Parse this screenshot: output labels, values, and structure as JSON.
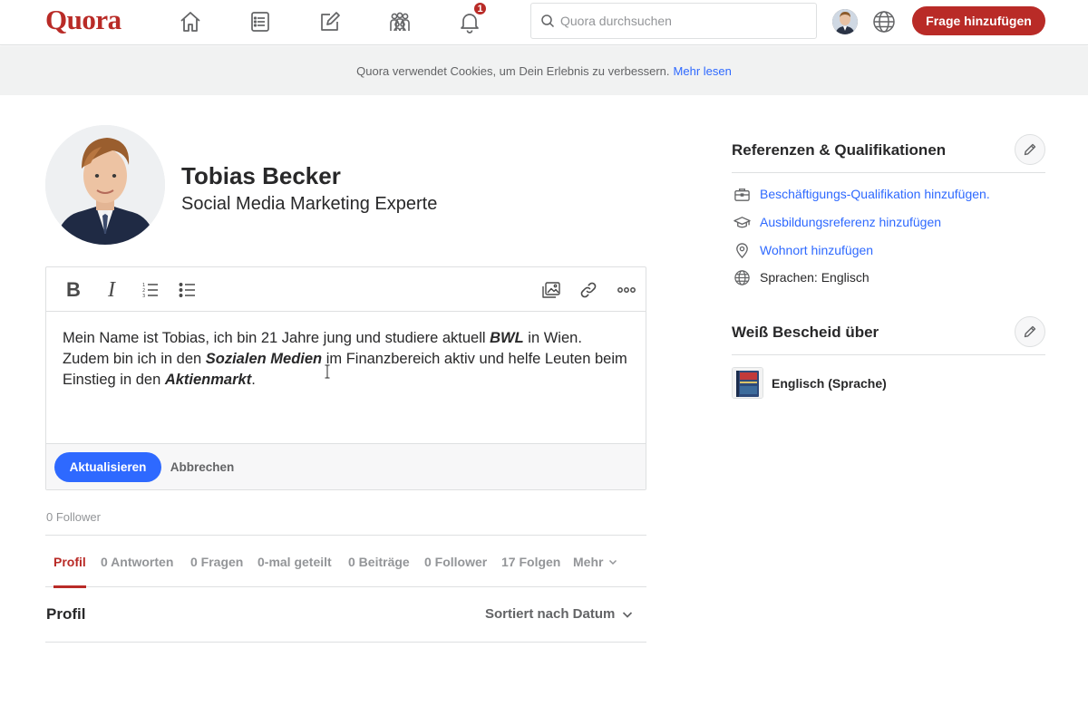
{
  "app": {
    "logo": "Quora",
    "brand_color": "#b92b27",
    "link_color": "#2e69ff",
    "notification_count": "1"
  },
  "nav": {
    "icons": [
      "home-icon",
      "answer-list-icon",
      "write-icon",
      "spaces-icon",
      "notifications-icon"
    ],
    "search_placeholder": "Quora durchsuchen",
    "add_question_label": "Frage hinzufügen"
  },
  "cookie_banner": {
    "text": "Quora verwendet Cookies, um Dein Erlebnis zu verbessern.",
    "link": "Mehr lesen"
  },
  "profile": {
    "name": "Tobias Becker",
    "headline": "Social Media Marketing Experte",
    "followers": "0 Follower"
  },
  "editor": {
    "toolbar": {
      "bold": "B",
      "italic": "I"
    },
    "bio": {
      "part1": "Mein Name ist Tobias, ich bin 21 Jahre jung und studiere aktuell ",
      "bold1": "BWL",
      "part2": " in Wien. Zudem bin ich in den ",
      "bold2": "Sozialen Medien",
      "part3": " im Finanzbereich aktiv und helfe Leuten beim Einstieg in den ",
      "bold3": "Aktienmarkt",
      "part4": "."
    },
    "update_label": "Aktualisieren",
    "cancel_label": "Abbrechen"
  },
  "tabs": [
    {
      "label": "Profil",
      "active": true
    },
    {
      "label": "0 Antworten"
    },
    {
      "label": "0 Fragen"
    },
    {
      "label": "0-mal geteilt"
    },
    {
      "label": "0 Beiträge"
    },
    {
      "label": "0 Follower"
    },
    {
      "label": "17 Folgen"
    },
    {
      "label": "Mehr"
    }
  ],
  "feed": {
    "title": "Profil",
    "sort_label": "Sortiert nach Datum"
  },
  "sidebar": {
    "credentials_title": "Referenzen & Qualifikationen",
    "credentials": [
      {
        "icon": "briefcase-icon",
        "label": "Beschäftigungs-Qualifikation hinzufügen.",
        "link": true
      },
      {
        "icon": "graduation-cap-icon",
        "label": "Ausbildungsreferenz hinzufügen",
        "link": true
      },
      {
        "icon": "location-pin-icon",
        "label": "Wohnort hinzufügen",
        "link": true
      },
      {
        "icon": "globe-icon",
        "label": "Sprachen: Englisch",
        "link": false
      }
    ],
    "knows_title": "Weiß Bescheid über",
    "topics": [
      {
        "icon": "dictionary-book-icon",
        "label": "Englisch (Sprache)"
      }
    ]
  }
}
